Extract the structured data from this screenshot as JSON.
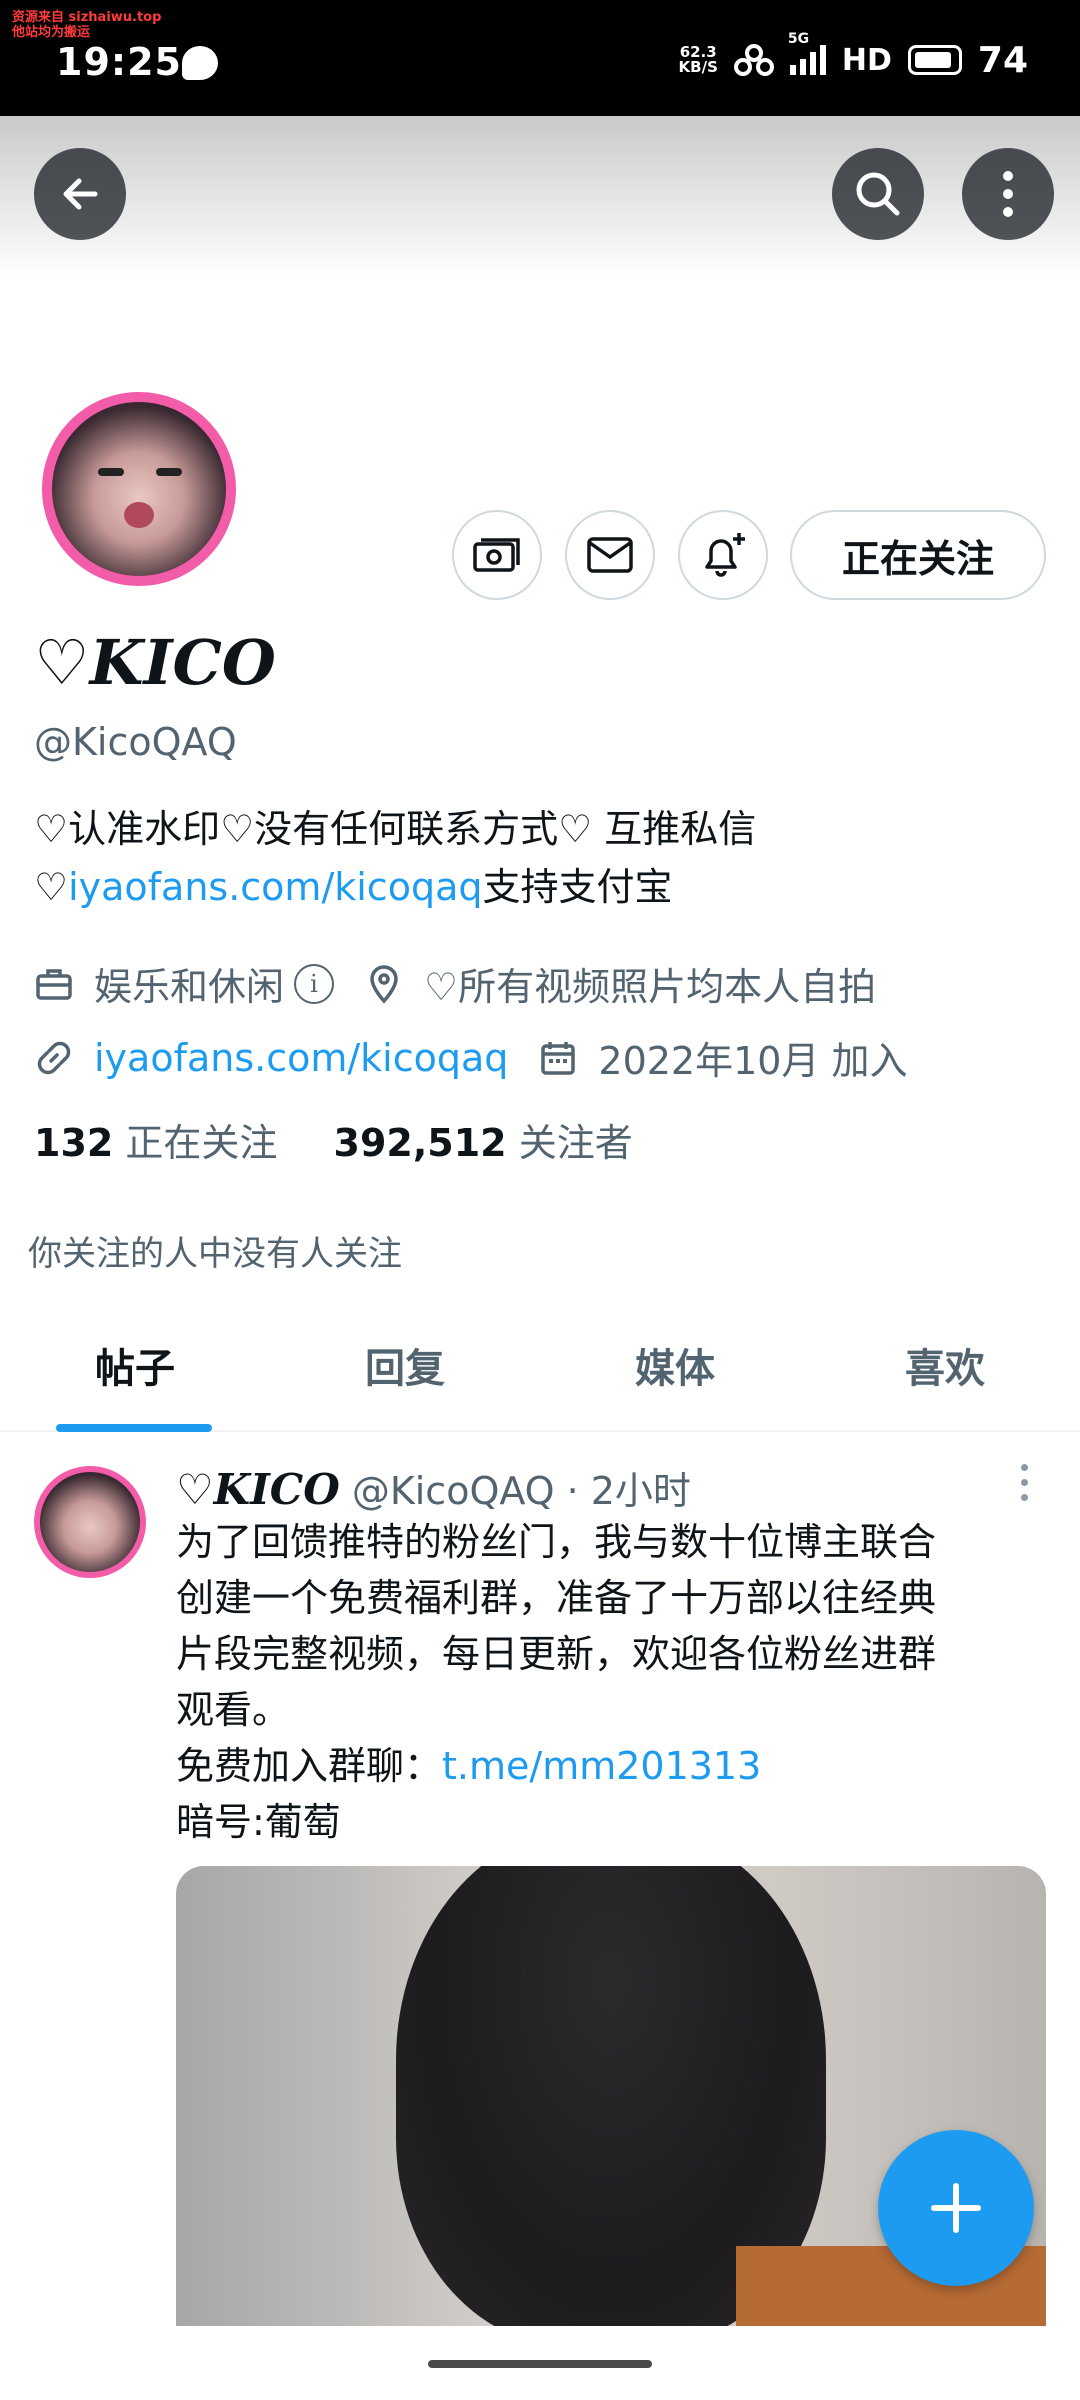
{
  "status_bar": {
    "watermark_line1": "资源来自 sizhaiwu.top",
    "watermark_line2": "他站均为搬运",
    "time": "19:25",
    "net_speed_top": "62.3",
    "net_speed_bottom": "KB/S",
    "signal_label": "5G",
    "hd_label": "HD",
    "battery": "74"
  },
  "profile": {
    "display_name": "♡KICO",
    "handle": "@KicoQAQ",
    "follow_button": "正在关注",
    "bio_line1": "♡认准水印♡没有任何联系方式♡ 互推私信",
    "bio_line2_prefix": "♡",
    "bio_line2_link": "iyaofans.com/kicoqaq",
    "bio_line2_suffix": "支持支付宝",
    "category": "娱乐和休闲",
    "location": "♡所有视频照片均本人自拍",
    "website": "iyaofans.com/kicoqaq",
    "joined": "2022年10月 加入",
    "following_count": "132",
    "following_label": "正在关注",
    "followers_count": "392,512",
    "followers_label": "关注者",
    "mutuals_text": "你关注的人中没有人关注"
  },
  "tabs": [
    {
      "label": "帖子",
      "active": true
    },
    {
      "label": "回复",
      "active": false
    },
    {
      "label": "媒体",
      "active": false
    },
    {
      "label": "喜欢",
      "active": false
    }
  ],
  "post": {
    "author_name": "♡KICO",
    "author_handle": "@KicoQAQ",
    "time": "· 2小时",
    "line1": "为了回馈推特的粉丝门，我与数十位博主联合",
    "line2": "创建一个免费福利群，准备了十万部以往经典",
    "line3": "片段完整视频，每日更新，欢迎各位粉丝进群",
    "line4": "观看。",
    "join_prefix": "免费加入群聊：",
    "join_link": "t.me/mm201313",
    "password": "暗号:葡萄"
  },
  "colors": {
    "accent": "#1d9bf0",
    "avatar_ring": "#f25ca9",
    "secondary_text": "#536471"
  }
}
